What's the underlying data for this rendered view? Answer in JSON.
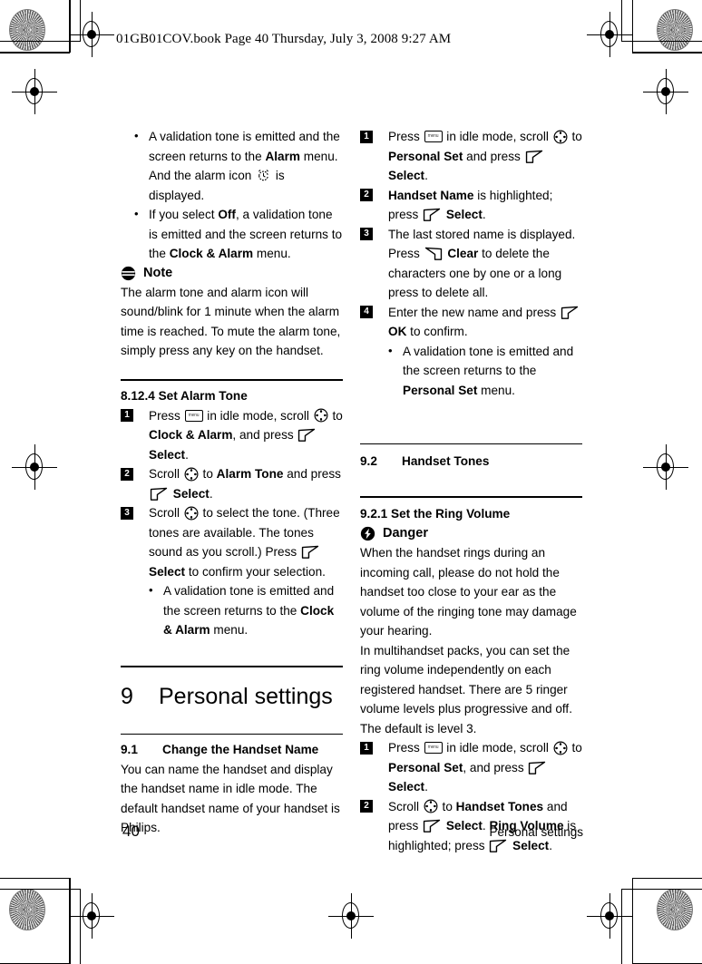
{
  "header": {
    "file_info": "01GB01COV.book  Page 40  Thursday, July 3, 2008  9:27 AM"
  },
  "footer": {
    "page_number": "40",
    "chapter_title": "Personal settings"
  },
  "icons": {
    "menu_key": "menu-key-icon",
    "menu_key_label": "menu",
    "nav_key": "four-way-scroll-key-icon",
    "soft_key_left": "left-soft-key-icon",
    "soft_key_right": "right-soft-key-icon",
    "alarm_clock": "alarm-clock-icon",
    "note": "note-icon",
    "danger": "danger-icon"
  },
  "left_column": {
    "top_bullets": [
      {
        "parts": [
          {
            "t": "A validation tone is emitted and the screen returns to the ",
            "b": false
          },
          {
            "t": "Alarm",
            "b": true
          },
          {
            "t": " menu. And the alarm icon ",
            "b": false
          },
          {
            "t": "[alarm-icon]",
            "icon": "alarm"
          },
          {
            "t": " is displayed.",
            "b": false
          }
        ]
      },
      {
        "parts": [
          {
            "t": "If you select ",
            "b": false
          },
          {
            "t": "Off",
            "b": true
          },
          {
            "t": ", a validation tone is emitted and the screen returns to the ",
            "b": false
          },
          {
            "t": "Clock & Alarm",
            "b": true
          },
          {
            "t": " menu.",
            "b": false
          }
        ]
      }
    ],
    "note": {
      "label": "Note",
      "body": "The alarm tone and alarm icon will sound/blink for 1 minute when the alarm time is reached. To mute the alarm tone, simply press any key on the handset."
    },
    "section_8124": {
      "heading": "8.12.4 Set Alarm Tone",
      "steps": [
        {
          "parts": [
            {
              "t": "Press ",
              "b": false
            },
            {
              "t": "[menu-key]",
              "icon": "menu"
            },
            {
              "t": " in idle mode, scroll ",
              "b": false
            },
            {
              "t": "[nav-key]",
              "icon": "nav"
            },
            {
              "t": " to ",
              "b": false
            },
            {
              "t": "Clock & Alarm",
              "b": true
            },
            {
              "t": ", and press ",
              "b": false
            },
            {
              "t": "[soft-key-left]",
              "icon": "softl"
            },
            {
              "t": " ",
              "b": false
            },
            {
              "t": "Select",
              "b": true
            },
            {
              "t": ".",
              "b": false
            }
          ]
        },
        {
          "parts": [
            {
              "t": "Scroll ",
              "b": false
            },
            {
              "t": "[nav-key]",
              "icon": "nav"
            },
            {
              "t": " to ",
              "b": false
            },
            {
              "t": "Alarm Tone",
              "b": true
            },
            {
              "t": " and press ",
              "b": false
            },
            {
              "t": "[soft-key-left]",
              "icon": "softl"
            },
            {
              "t": " ",
              "b": false
            },
            {
              "t": "Select",
              "b": true
            },
            {
              "t": ".",
              "b": false
            }
          ]
        },
        {
          "parts": [
            {
              "t": "Scroll ",
              "b": false
            },
            {
              "t": "[nav-key]",
              "icon": "nav"
            },
            {
              "t": " to select the tone. (Three tones are available. The tones sound as you scroll.) Press ",
              "b": false
            },
            {
              "t": "[soft-key-left]",
              "icon": "softl"
            },
            {
              "t": " ",
              "b": false
            },
            {
              "t": "Select",
              "b": true
            },
            {
              "t": " to confirm your selection.",
              "b": false
            }
          ],
          "sub_bullets": [
            {
              "parts": [
                {
                  "t": "A validation tone is emitted and the screen returns to the ",
                  "b": false
                },
                {
                  "t": "Clock & Alarm",
                  "b": true
                },
                {
                  "t": " menu.",
                  "b": false
                }
              ]
            }
          ]
        }
      ]
    },
    "chapter_9": {
      "number": "9",
      "title": "Personal settings"
    },
    "section_91": {
      "number": "9.1",
      "title": "Change the Handset Name",
      "body": "You can name the handset and display the handset name in idle mode. The default handset name of your handset is Philips."
    }
  },
  "right_column": {
    "section_91_steps": [
      {
        "parts": [
          {
            "t": "Press ",
            "b": false
          },
          {
            "t": "[menu-key]",
            "icon": "menu"
          },
          {
            "t": " in idle mode, scroll ",
            "b": false
          },
          {
            "t": "[nav-key]",
            "icon": "nav"
          },
          {
            "t": " to ",
            "b": false
          },
          {
            "t": "Personal Set",
            "b": true
          },
          {
            "t": " and press ",
            "b": false
          },
          {
            "t": "[soft-key-left]",
            "icon": "softl"
          },
          {
            "t": " ",
            "b": false
          },
          {
            "t": "Select",
            "b": true
          },
          {
            "t": ".",
            "b": false
          }
        ]
      },
      {
        "parts": [
          {
            "t": "Handset Name",
            "b": true
          },
          {
            "t": " is highlighted; press ",
            "b": false
          },
          {
            "t": "[soft-key-left]",
            "icon": "softl"
          },
          {
            "t": " ",
            "b": false
          },
          {
            "t": "Select",
            "b": true
          },
          {
            "t": ".",
            "b": false
          }
        ]
      },
      {
        "parts": [
          {
            "t": "The last stored name is displayed. Press ",
            "b": false
          },
          {
            "t": "[soft-key-right]",
            "icon": "softr"
          },
          {
            "t": " ",
            "b": false
          },
          {
            "t": "Clear",
            "b": true
          },
          {
            "t": " to delete the characters one by one or a long press to delete all.",
            "b": false
          }
        ]
      },
      {
        "parts": [
          {
            "t": "Enter the new name and press ",
            "b": false
          },
          {
            "t": "[soft-key-left]",
            "icon": "softl"
          },
          {
            "t": " ",
            "b": false
          },
          {
            "t": "OK",
            "b": true
          },
          {
            "t": " to confirm.",
            "b": false
          }
        ],
        "sub_bullets": [
          {
            "parts": [
              {
                "t": "A validation tone is emitted and the screen returns to the ",
                "b": false
              },
              {
                "t": "Personal Set",
                "b": true
              },
              {
                "t": " menu.",
                "b": false
              }
            ]
          }
        ]
      }
    ],
    "section_92": {
      "number": "9.2",
      "title": "Handset Tones"
    },
    "section_921": {
      "heading": "9.2.1   Set the Ring Volume",
      "danger_label": "Danger",
      "danger_body": "When the handset rings during an incoming call, please do not hold the handset too close to your ear as the volume of the ringing tone may damage your hearing.",
      "body2": "In multihandset packs, you can set the ring volume independently on each registered handset. There are 5 ringer volume levels plus progressive and off. The default is level 3.",
      "steps": [
        {
          "parts": [
            {
              "t": "Press ",
              "b": false
            },
            {
              "t": "[menu-key]",
              "icon": "menu"
            },
            {
              "t": " in idle mode, scroll ",
              "b": false
            },
            {
              "t": "[nav-key]",
              "icon": "nav"
            },
            {
              "t": " to ",
              "b": false
            },
            {
              "t": "Personal Set",
              "b": true
            },
            {
              "t": ", and press ",
              "b": false
            },
            {
              "t": "[soft-key-left]",
              "icon": "softl"
            },
            {
              "t": " ",
              "b": false
            },
            {
              "t": "Select",
              "b": true
            },
            {
              "t": ".",
              "b": false
            }
          ]
        },
        {
          "parts": [
            {
              "t": "Scroll ",
              "b": false
            },
            {
              "t": "[nav-key]",
              "icon": "nav"
            },
            {
              "t": " to ",
              "b": false
            },
            {
              "t": "Handset Tones",
              "b": true
            },
            {
              "t": " and press ",
              "b": false
            },
            {
              "t": "[soft-key-left]",
              "icon": "softl"
            },
            {
              "t": " ",
              "b": false
            },
            {
              "t": "Select",
              "b": true
            },
            {
              "t": ". ",
              "b": false
            },
            {
              "t": "Ring Volume",
              "b": true
            },
            {
              "t": " is highlighted; press ",
              "b": false
            },
            {
              "t": "[soft-key-left]",
              "icon": "softl"
            },
            {
              "t": " ",
              "b": false
            },
            {
              "t": "Select",
              "b": true
            },
            {
              "t": ".",
              "b": false
            }
          ]
        }
      ]
    }
  }
}
